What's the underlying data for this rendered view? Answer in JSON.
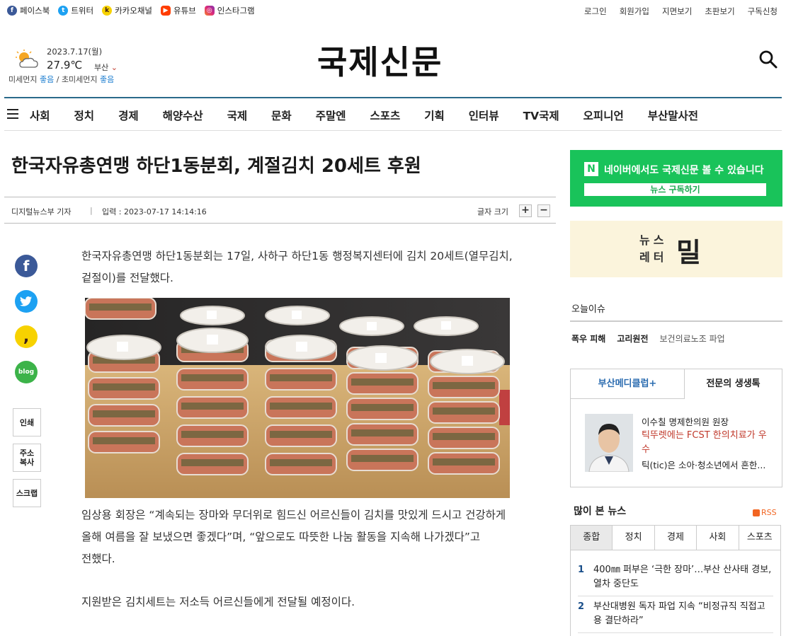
{
  "social": [
    {
      "label": "페이스북",
      "icon": "facebook-icon"
    },
    {
      "label": "트위터",
      "icon": "twitter-icon"
    },
    {
      "label": "카카오채널",
      "icon": "kakao-icon"
    },
    {
      "label": "유튜브",
      "icon": "youtube-icon"
    },
    {
      "label": "인스타그램",
      "icon": "instagram-icon"
    }
  ],
  "top_links": [
    "로그인",
    "회원가입",
    "지면보기",
    "초판보기",
    "구독신청"
  ],
  "weather": {
    "date": "2023.7.17(월)",
    "temp": "27.9℃",
    "city": "부산",
    "dust_label": "미세먼지",
    "dust_value": "좋음",
    "ultra_label": "초미세먼지",
    "ultra_value": "좋음"
  },
  "logo": "국제신문",
  "nav": [
    "사회",
    "정치",
    "경제",
    "해양수산",
    "국제",
    "문화",
    "주말엔",
    "스포츠",
    "기획",
    "인터뷰",
    "TV국제",
    "오피니언",
    "부산말사전"
  ],
  "article": {
    "title": "한국자유총연맹 하단1동분회, 계절김치 20세트 후원",
    "author": "디지털뉴스부 기자",
    "date": "입력 : 2023-07-17 14:14:16",
    "font_size_label": "글자 크기",
    "para1": "한국자유총연맹 하단1동분회는 17일, 사하구 하단1동 행정복지센터에 김치 20세트(열무김치, 겉절이)를 전달했다.",
    "para2": "임상용 회장은 “계속되는 장마와 무더위로 힘드신 어르신들이 김치를 맛있게 드시고 건강하게 올해 여름을 잘 보냈으면 좋겠다”며, “앞으로도 따뜻한 나눔 활동을 지속해 나가겠다”고 전했다.",
    "para3": "지원받은 김치세트는 저소득 어르신들에게 전달될 예정이다."
  },
  "share_tools": [
    "인쇄",
    "주소복사",
    "스크랩"
  ],
  "share_colors": {
    "facebook": "#3b5998",
    "twitter": "#1da1f2",
    "kakao": "#f7d200",
    "blog": "#3cb349"
  },
  "naver": {
    "text": "네이버에서도 국제신문 볼 수 있습니다",
    "button": "뉴스 구독하기"
  },
  "newsletter": {
    "text1": "뉴스",
    "text2": "레터",
    "logo": "밀"
  },
  "today_issue": {
    "title": "오늘이슈",
    "items": [
      "폭우 피해",
      "고리원전",
      "보건의료노조 파업"
    ]
  },
  "medical": {
    "tab1": "부산메디클럽+",
    "tab2": "전문의 생생톡",
    "name": "이수칠 명제한의원 원장",
    "title": "틱뚜렛에는 FCST 한의치료가 우수",
    "summary": "틱(tic)은 소아·청소년에서 흔한..."
  },
  "most_viewed": {
    "title": "많이 본 뉴스",
    "rss": "RSS",
    "tabs": [
      "종합",
      "정치",
      "경제",
      "사회",
      "스포츠"
    ],
    "items": [
      {
        "num": "1",
        "text": "400㎜ 퍼부은 ‘극한 장마’…부산 산사태 경보, 열차 중단도"
      },
      {
        "num": "2",
        "text": "부산대병원 독자 파업 지속 “비정규직 직접고용 결단하라”"
      }
    ]
  }
}
